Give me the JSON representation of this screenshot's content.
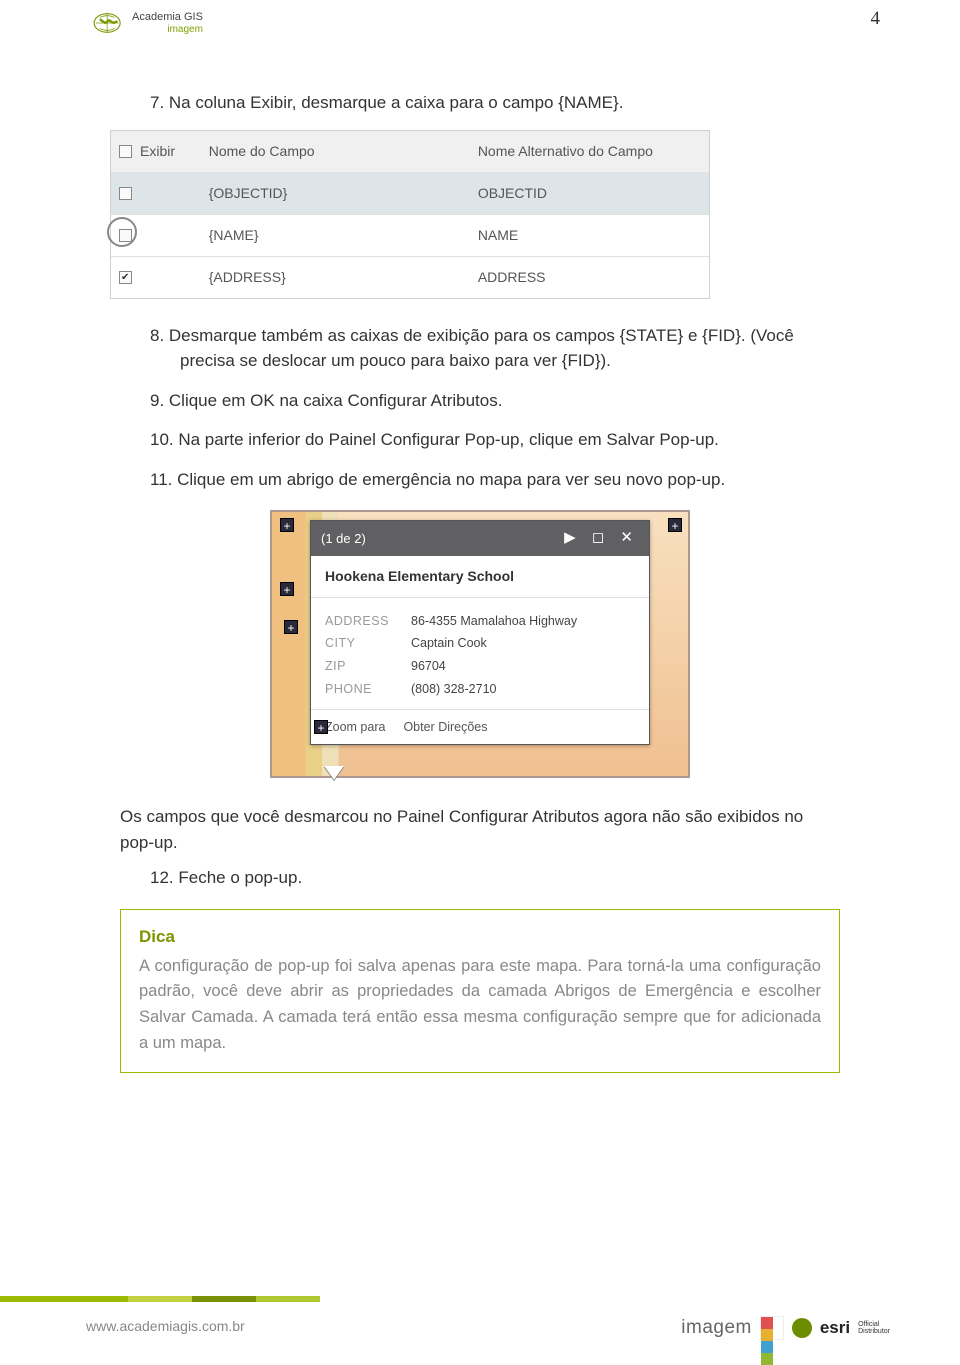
{
  "page_number": "4",
  "header_logo": {
    "line1": "Academia GIS",
    "line2": "imagem"
  },
  "items": {
    "p7": "7. Na coluna Exibir, desmarque a caixa para o campo {NAME}.",
    "p8": "8. Desmarque também as caixas de exibição para os campos {STATE} e {FID}. (Você precisa se deslocar um pouco para baixo para ver {FID}).",
    "p9": "9. Clique em OK na caixa Configurar Atributos.",
    "p10": "10. Na parte inferior do Painel Configurar Pop-up, clique em Salvar Pop-up.",
    "p11": "11. Clique em um abrigo de emergência no mapa para ver seu novo pop-up.",
    "para_after": "Os campos que você desmarcou no Painel Configurar Atributos agora não são exibidos no pop-up.",
    "p12": "12. Feche o pop-up."
  },
  "table": {
    "h1": "Exibir",
    "h2": "Nome do Campo",
    "h3": "Nome Alternativo do Campo",
    "r1c2": "{OBJECTID}",
    "r1c3": "OBJECTID",
    "r2c2": "{NAME}",
    "r2c3": "NAME",
    "r3c2": "{ADDRESS}",
    "r3c3": "ADDRESS"
  },
  "popup": {
    "pager": "(1 de 2)",
    "title": "Hookena Elementary School",
    "rows": [
      {
        "k": "ADDRESS",
        "v": "86-4355 Mamalahoa Highway"
      },
      {
        "k": "CITY",
        "v": "Captain Cook"
      },
      {
        "k": "ZIP",
        "v": "96704"
      },
      {
        "k": "PHONE",
        "v": "(808) 328-2710"
      }
    ],
    "foot1": "Zoom para",
    "foot2": "Obter Direções"
  },
  "dica": {
    "head": "Dica",
    "body": "A configuração de pop-up foi salva apenas para este mapa. Para torná-la uma configuração padrão, você deve abrir as propriedades da camada Abrigos de Emergência e escolher Salvar Camada. A camada terá então essa mesma configuração sempre que for adicionada a um mapa."
  },
  "footer": {
    "url": "www.academiagis.com.br",
    "imagem": "imagem",
    "esri": "esri",
    "esri_tag1": "Official",
    "esri_tag2": "Distributor"
  }
}
